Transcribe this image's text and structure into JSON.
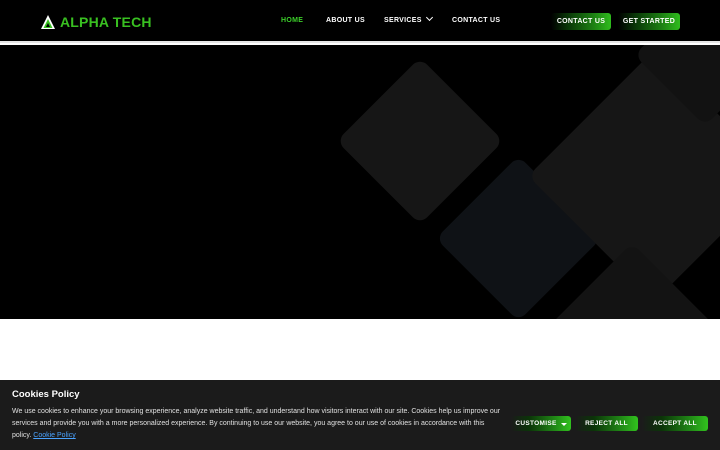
{
  "brand": {
    "name": "ALPHA TECH",
    "accent": "#39c021",
    "logo_icon": "triangle-logo-icon"
  },
  "nav": {
    "items": [
      {
        "label": "HOME",
        "active": true
      },
      {
        "label": "ABOUT US",
        "active": false
      },
      {
        "label": "SERVICES",
        "active": false,
        "has_dropdown": true,
        "dropdown_icon": "chevron-down-icon"
      },
      {
        "label": "CONTACT US",
        "active": false
      }
    ]
  },
  "header_buttons": {
    "contact": "CONTACT US",
    "get_started": "GET STARTED"
  },
  "cookie_banner": {
    "title": "Cookies Policy",
    "text": "We use cookies to enhance your browsing experience, analyze website traffic, and understand how visitors interact with our site. Cookies help us improve our services and provide you with a more personalized experience. By continuing to use our website, you agree to our use of cookies in accordance with this policy. ",
    "link_text": "Cookie Policy",
    "buttons": {
      "customise": "CUSTOMISE",
      "reject": "REJECT ALL",
      "accept": "ACCEPT ALL"
    }
  }
}
